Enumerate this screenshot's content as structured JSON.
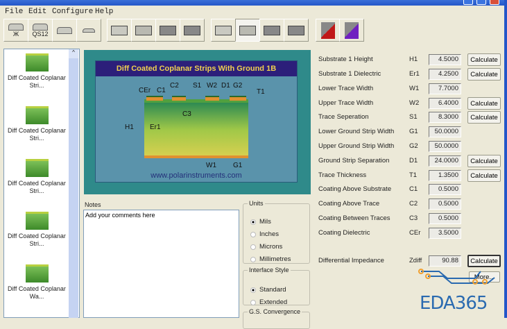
{
  "menu": [
    "File",
    "Edit",
    "Configure",
    "Help"
  ],
  "toolbar": {
    "qs12_label": "QS12",
    "x_label": "Ж"
  },
  "library": [
    {
      "label": "Diff Coated Coplanar Stri..."
    },
    {
      "label": "Diff Coated Coplanar Stri..."
    },
    {
      "label": "Diff Coated Coplanar Stri..."
    },
    {
      "label": "Diff Coated Coplanar Stri..."
    },
    {
      "label": "Diff Coated Coplanar Wa..."
    }
  ],
  "diagram": {
    "title": "Diff Coated Coplanar Strips With Ground  1B",
    "url": "www.polarinstruments.com",
    "labels": [
      "CEr",
      "C1",
      "C2",
      "S1",
      "W2",
      "D1",
      "G2",
      "T1",
      "C3",
      "H1",
      "Er1",
      "W1",
      "G1"
    ]
  },
  "notes": {
    "label": "Notes",
    "value": "Add your comments here"
  },
  "units": {
    "label": "Units",
    "options": [
      "Mils",
      "Inches",
      "Microns",
      "Millimetres"
    ],
    "selected": "Mils"
  },
  "interface": {
    "label": "Interface Style",
    "options": [
      "Standard",
      "Extended"
    ],
    "selected": "Standard"
  },
  "convergence": {
    "label": "G.S. Convergence"
  },
  "params": [
    {
      "label": "Substrate 1 Height",
      "sym": "H1",
      "value": "4.5000",
      "calc": "Calculate"
    },
    {
      "label": "Substrate 1 Dielectric",
      "sym": "Er1",
      "value": "4.2500",
      "calc": "Calculate"
    },
    {
      "label": "Lower Trace Width",
      "sym": "W1",
      "value": "7.7000"
    },
    {
      "label": "Upper Trace Width",
      "sym": "W2",
      "value": "6.4000",
      "calc": "Calculate"
    },
    {
      "label": "Trace Seperation",
      "sym": "S1",
      "value": "8.3000",
      "calc": "Calculate"
    },
    {
      "label": "Lower Ground Strip Width",
      "sym": "G1",
      "value": "50.0000"
    },
    {
      "label": "Upper Ground Strip Width",
      "sym": "G2",
      "value": "50.0000"
    },
    {
      "label": "Ground Strip Separation",
      "sym": "D1",
      "value": "24.0000",
      "calc": "Calculate"
    },
    {
      "label": "Trace Thickness",
      "sym": "T1",
      "value": "1.3500",
      "calc": "Calculate"
    },
    {
      "label": "Coating Above Substrate",
      "sym": "C1",
      "value": "0.5000"
    },
    {
      "label": "Coating Above Trace",
      "sym": "C2",
      "value": "0.5000"
    },
    {
      "label": "Coating Between Traces",
      "sym": "C3",
      "value": "0.5000"
    },
    {
      "label": "Coating Dielectric",
      "sym": "CEr",
      "value": "3.5000"
    }
  ],
  "result": {
    "label": "Differential Impedance",
    "sym": "Zdiff",
    "value": "90.88",
    "calc": "Calculate"
  },
  "more_label": "More...",
  "watermark": "EDA365"
}
